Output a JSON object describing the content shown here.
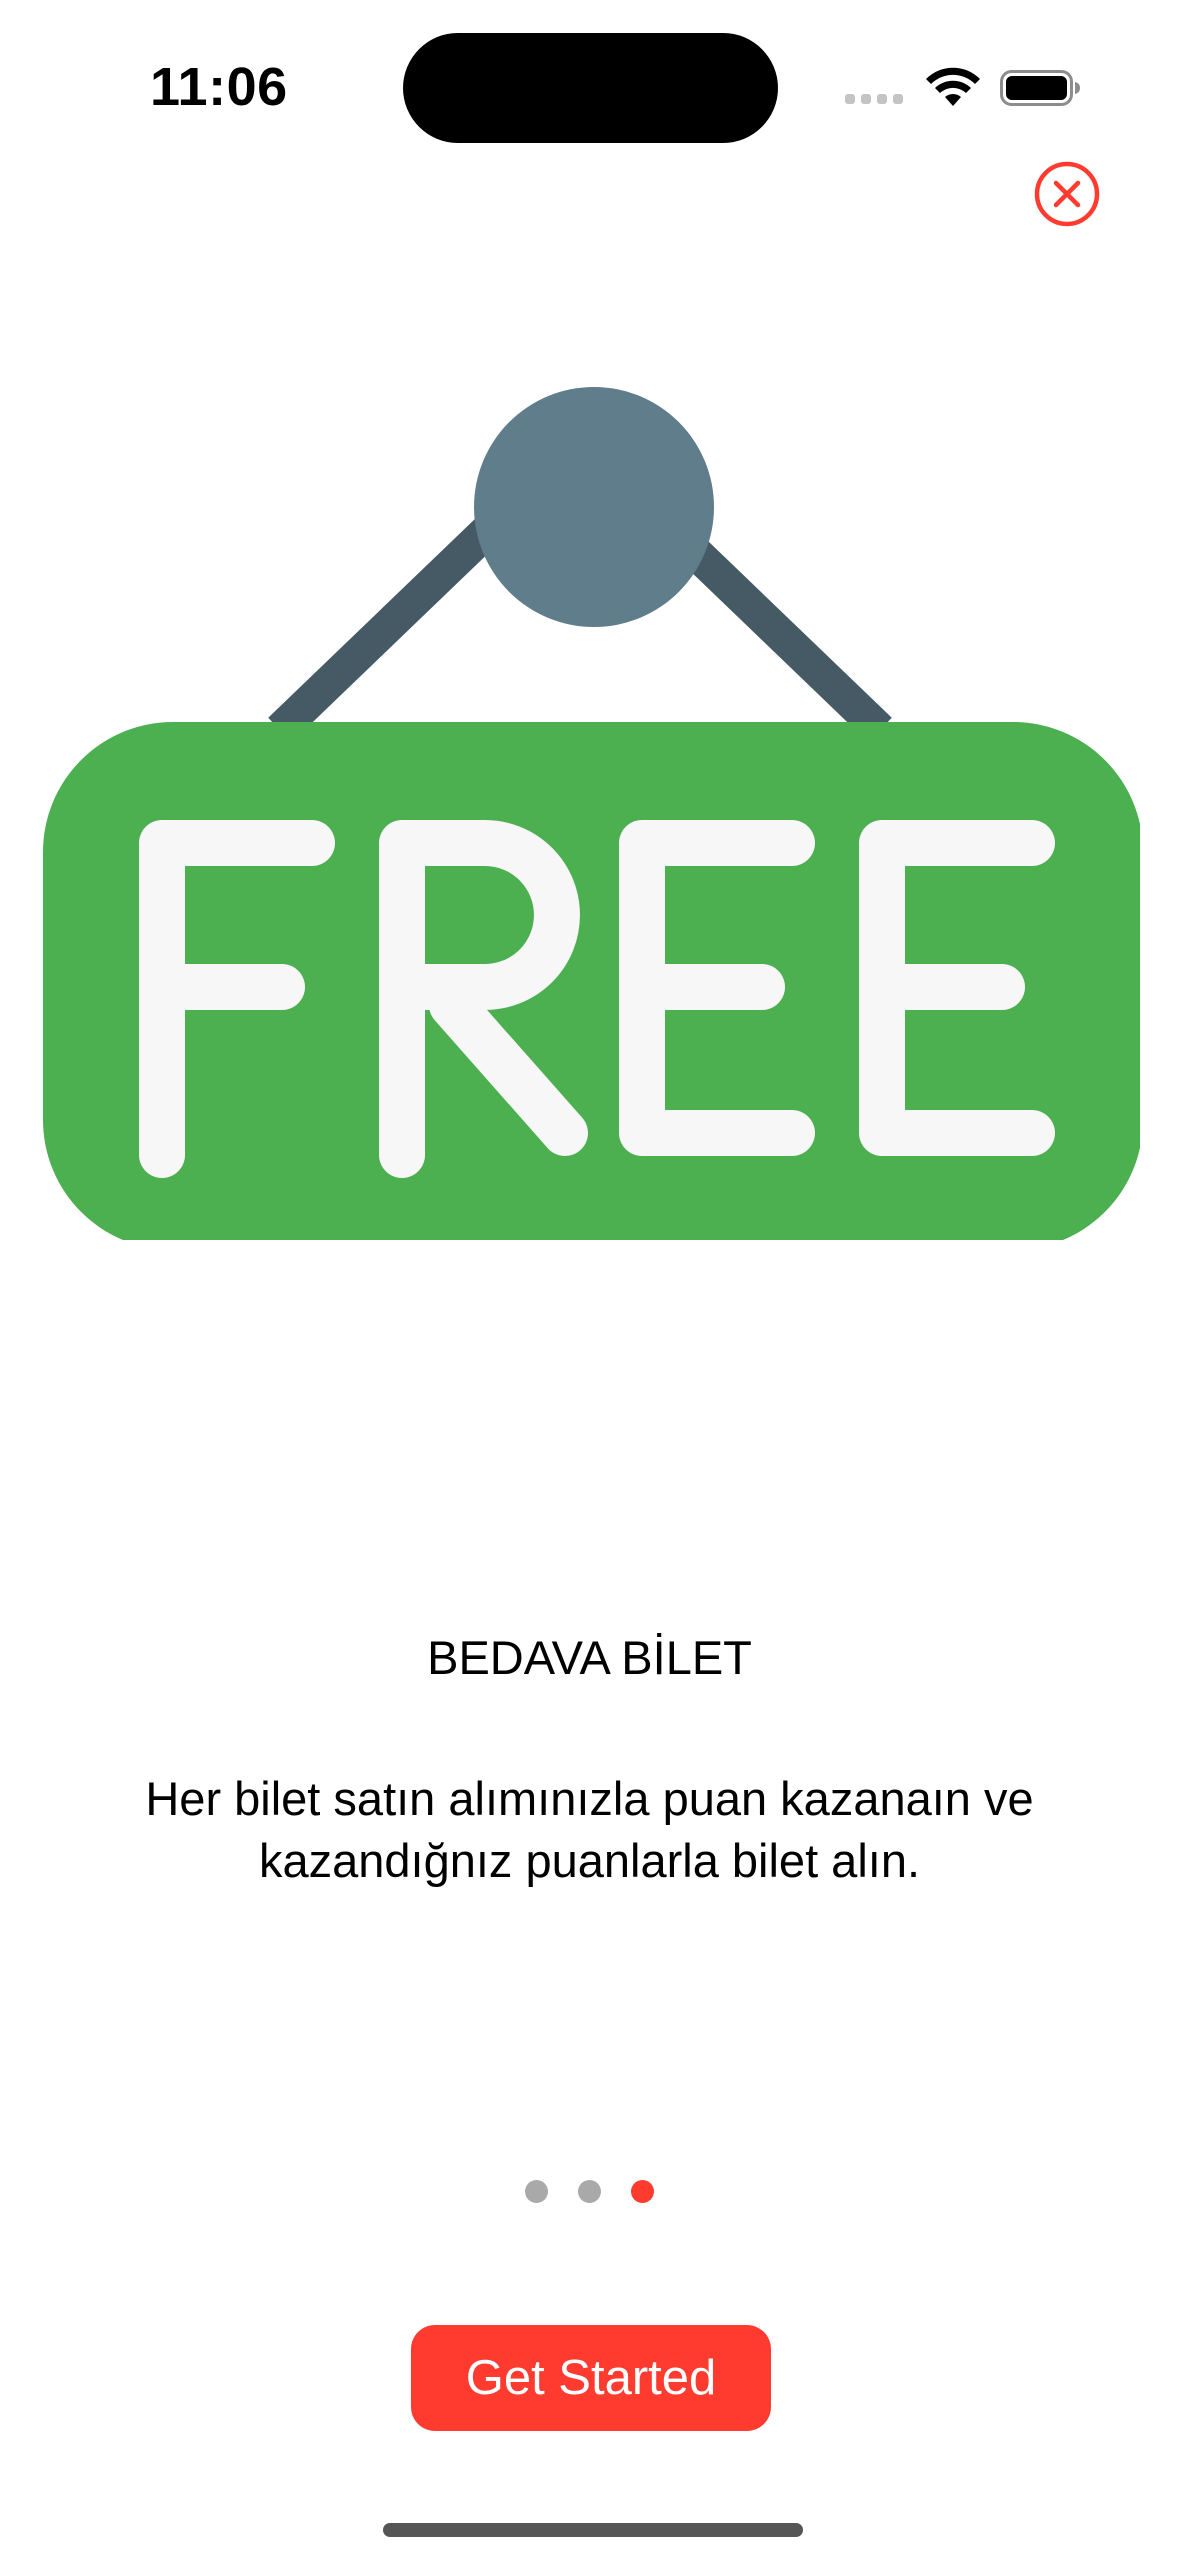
{
  "status_bar": {
    "time": "11:06"
  },
  "close_icon": "close-circle-icon",
  "illustration": {
    "sign_text": "FREE",
    "colors": {
      "sign": "#4caf50",
      "letters": "#f7f7f7",
      "pin": "#607d8b",
      "strings": "#455a64"
    }
  },
  "onboarding": {
    "title": "BEDAVA BİLET",
    "description": "Her bilet satın alımınızla puan kazanaın ve kazandığnız puanlarla bilet alın.",
    "pages": 3,
    "current_page": 3
  },
  "button": {
    "label": "Get Started"
  },
  "colors": {
    "accent": "#ff3b30",
    "inactive_dot": "#a9a9a9",
    "background": "#ffffff"
  }
}
